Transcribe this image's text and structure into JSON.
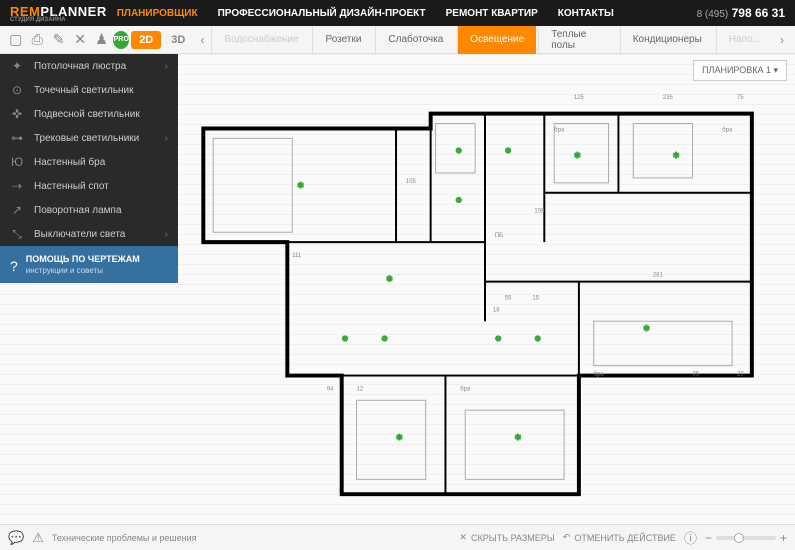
{
  "header": {
    "logo1": "REM",
    "logo2": "PLANNER",
    "logoSub": "СТУДИЯ ДИЗАЙНА",
    "nav": [
      "ПЛАНИРОВЩИК",
      "ПРОФЕССИОНАЛЬНЫЙ ДИЗАЙН-ПРОЕКТ",
      "РЕМОНТ КВАРТИР",
      "КОНТАКТЫ"
    ],
    "phonePre": "8 (495)",
    "phone": "798 66 31"
  },
  "toolbar": {
    "view2d": "2D",
    "view3d": "3D",
    "tabs": [
      "Водоснабжение",
      "Розетки",
      "Слаботочка",
      "Освещение",
      "Теплые полы",
      "Кондиционеры",
      "Напо..."
    ],
    "activeTab": 3
  },
  "sidebar": {
    "items": [
      {
        "label": "Потолочная люстра",
        "chevron": true
      },
      {
        "label": "Точечный светильник",
        "chevron": false
      },
      {
        "label": "Подвесной светильник",
        "chevron": false
      },
      {
        "label": "Трековые светильники",
        "chevron": true
      },
      {
        "label": "Настенный бра",
        "chevron": false
      },
      {
        "label": "Настенный спот",
        "chevron": false
      },
      {
        "label": "Поворотная лампа",
        "chevron": false
      },
      {
        "label": "Выключатели света",
        "chevron": true
      }
    ],
    "helpTitle": "ПОМОЩЬ ПО ЧЕРТЕЖАМ",
    "helpSub": "инструкции и советы"
  },
  "layoutDropdown": "ПЛАНИРОВКА 1",
  "floorplan": {
    "dims": [
      "125",
      "235",
      "75",
      "105",
      "111",
      "108",
      "281",
      "94",
      "12",
      "55",
      "18",
      "15",
      "95",
      "29"
    ],
    "labels": [
      "бра",
      "бра",
      "бра",
      "бра",
      "ПБ"
    ]
  },
  "footer": {
    "techLink": "Технические проблемы и решения",
    "hideDims": "СКРЫТЬ РАЗМЕРЫ",
    "undo": "ОТМЕНИТЬ ДЕЙСТВИЕ"
  }
}
